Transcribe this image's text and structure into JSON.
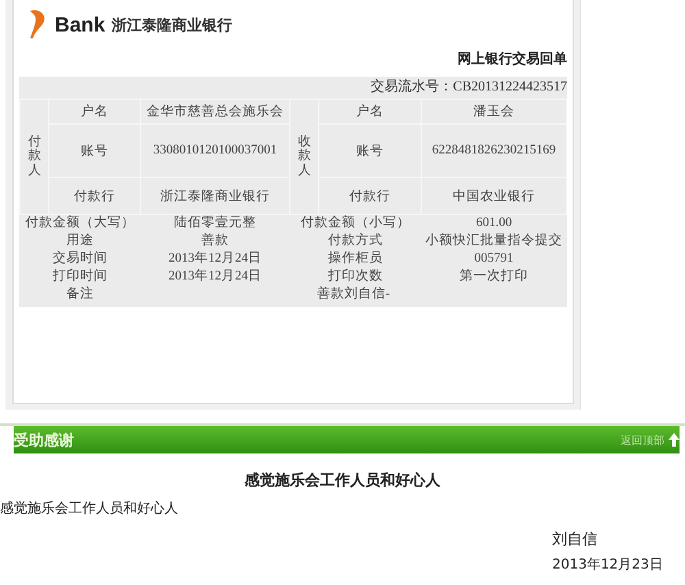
{
  "receipt": {
    "logo": {
      "brand": "Bank",
      "bank_name": "浙江泰隆商业银行"
    },
    "title": "网上银行交易回单",
    "serial": "交易流水号：CB20131224423517",
    "payer": {
      "side_label": "付款人",
      "name_label": "户名",
      "name": "金华市慈善总会施乐会",
      "account_label": "账号",
      "account": "3308010120100037001",
      "bank_label": "付款行",
      "bank": "浙江泰隆商业银行"
    },
    "payee": {
      "side_label": "收款人",
      "name_label": "户名",
      "name": "潘玉会",
      "account_label": "账号",
      "account": "6228481826230215169",
      "bank_label": "付款行",
      "bank": "中国农业银行"
    },
    "rows": [
      {
        "label": "付款金额（大写）",
        "value": "陆佰零壹元整",
        "label2": "付款金额（小写）",
        "value2": "601.00"
      },
      {
        "label": "用途",
        "value": "善款",
        "label2": "付款方式",
        "value2": "小额快汇批量指令提交"
      },
      {
        "label": "交易时间",
        "value": "2013年12月24日",
        "label2": "操作柜员",
        "value2": "005791"
      },
      {
        "label": "打印时间",
        "value": "2013年12月24日",
        "label2": "打印次数",
        "value2": "第一次打印"
      }
    ],
    "remark": {
      "label": "备注",
      "value": "善款刘自信-"
    }
  },
  "section": {
    "title": "受助感谢",
    "top_link": "返回顶部"
  },
  "letter": {
    "heading": "感觉施乐会工作人员和好心人",
    "body": "感觉施乐会工作人员和好心人",
    "signature": "刘自信",
    "date": "2013年12月23日"
  }
}
